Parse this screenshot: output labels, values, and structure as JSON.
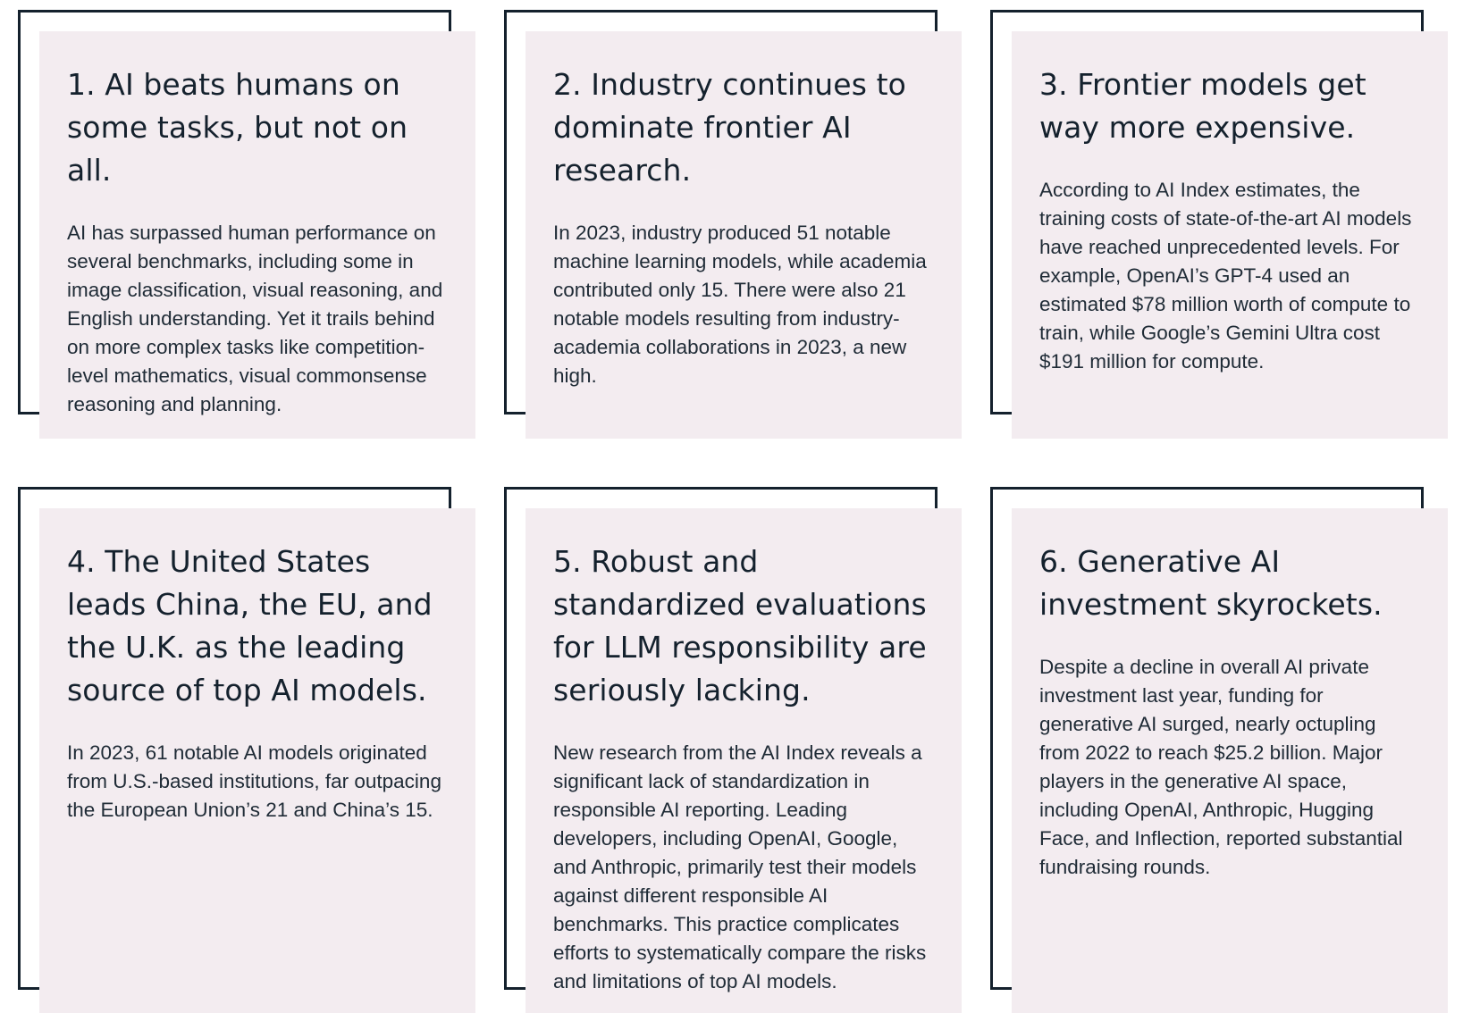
{
  "cards": [
    {
      "title": "1. AI beats humans on some tasks, but not on all.",
      "body": "AI has surpassed human performance on several benchmarks, including some in image classification, visual reasoning, and English understanding. Yet it trails behind on more complex tasks like competition-level mathematics, visual commonsense reasoning and planning."
    },
    {
      "title": "2. Industry continues to dominate frontier AI research.",
      "body": " In 2023, industry produced 51 notable machine learning models, while academia contributed only 15. There were also 21 notable models resulting from industry-academia collaborations in 2023, a new high."
    },
    {
      "title": "3. Frontier models get way more expensive.",
      "body": "According to AI Index estimates, the training costs of state-of-the-art AI models have reached unprecedented levels. For example, OpenAI’s GPT-4 used an estimated $78 million worth of compute to train, while Google’s Gemini Ultra cost $191 million for compute."
    },
    {
      "title": "4. The United States leads China, the EU, and the U.K. as the leading source of top AI models.",
      "body": " In 2023, 61 notable AI models originated from U.S.-based institutions, far outpacing the European Union’s 21 and China’s 15."
    },
    {
      "title": "5. Robust and standardized evaluations for LLM responsibility are seriously lacking.",
      "body": "New research from the AI Index reveals a significant lack of standardization in responsible AI reporting. Leading developers, including OpenAI, Google, and Anthropic, primarily test their models against different responsible AI benchmarks. This practice complicates efforts to systematically compare the risks and limitations of top AI models."
    },
    {
      "title": "6. Generative AI investment skyrockets.",
      "body": "Despite a decline in overall AI private investment last year, funding for generative AI surged, nearly octupling from 2022 to reach $25.2 billion. Major players in the generative AI space, including OpenAI, Anthropic, Hugging Face, and Inflection, reported substantial fundraising rounds."
    }
  ],
  "colors": {
    "card_background": "#f3ecf0",
    "frame_border": "#14212d",
    "title_text": "#14212d",
    "body_text": "#1f2b36"
  }
}
